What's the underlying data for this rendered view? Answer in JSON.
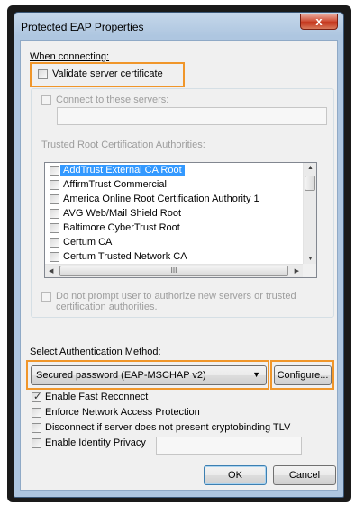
{
  "window": {
    "title": "Protected EAP Properties",
    "close_glyph": "x"
  },
  "connecting": {
    "heading": "When connecting:",
    "validate_cert": {
      "label": "Validate server certificate",
      "checked": false
    },
    "connect_servers": {
      "label": "Connect to these servers:",
      "checked": false,
      "value": ""
    },
    "trusted_ca_heading": "Trusted Root Certification Authorities:",
    "authorities": [
      {
        "label": "AddTrust External CA Root",
        "checked": false,
        "selected": true
      },
      {
        "label": "AffirmTrust Commercial",
        "checked": false,
        "selected": false
      },
      {
        "label": "America Online Root Certification Authority 1",
        "checked": false,
        "selected": false
      },
      {
        "label": "AVG Web/Mail Shield Root",
        "checked": false,
        "selected": false
      },
      {
        "label": "Baltimore CyberTrust Root",
        "checked": false,
        "selected": false
      },
      {
        "label": "Certum CA",
        "checked": false,
        "selected": false
      },
      {
        "label": "Certum Trusted Network CA",
        "checked": false,
        "selected": false
      }
    ],
    "scroll_glyphs": {
      "up": "▲",
      "down": "▼",
      "left": "◀",
      "right": "▶",
      "grip": "III"
    },
    "do_not_prompt": {
      "label": "Do not prompt user to authorize new servers or trusted certification authorities.",
      "checked": false
    }
  },
  "auth": {
    "heading": "Select Authentication Method:",
    "method_selected": "Secured password (EAP-MSCHAP v2)",
    "dropdown_glyph": "▼",
    "configure_label": "Configure..."
  },
  "options": {
    "fast_reconnect": {
      "label": "Enable Fast Reconnect",
      "checked": true
    },
    "nap": {
      "label": "Enforce Network Access Protection",
      "checked": false
    },
    "cryptobinding": {
      "label": "Disconnect if server does not present cryptobinding TLV",
      "checked": false
    },
    "identity_privacy": {
      "label": "Enable Identity Privacy",
      "checked": false,
      "value": ""
    }
  },
  "buttons": {
    "ok": "OK",
    "cancel": "Cancel"
  },
  "colors": {
    "highlight": "#f0962a",
    "selection": "#3399ff",
    "title_bar": "#aec6e0"
  }
}
